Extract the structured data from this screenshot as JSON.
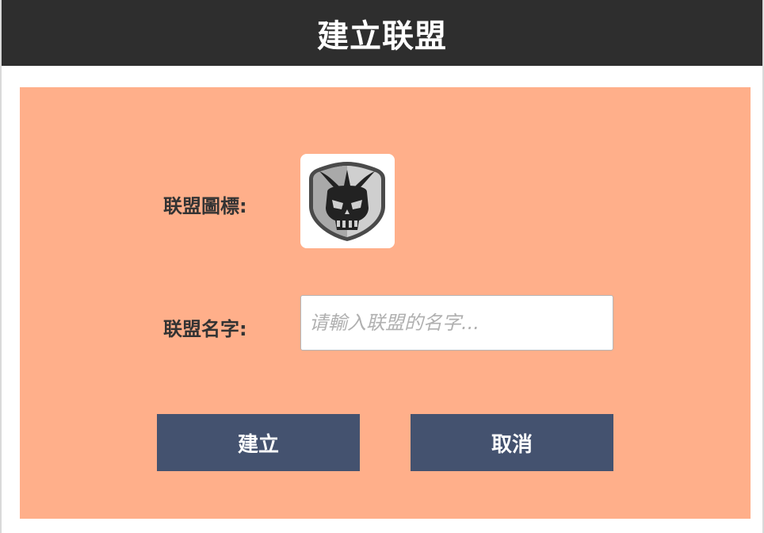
{
  "header": {
    "title": "建立联盟"
  },
  "form": {
    "emblem_label": "联盟圖標:",
    "emblem_icon": "skull-shield-emblem-icon",
    "name_label": "联盟名字:",
    "name_value": "",
    "name_placeholder": "请輸入联盟的名字..."
  },
  "actions": {
    "create_label": "建立",
    "cancel_label": "取消"
  },
  "colors": {
    "titlebar": "#2e2e2e",
    "panel": "#ffaf8a",
    "button": "#44526f"
  }
}
